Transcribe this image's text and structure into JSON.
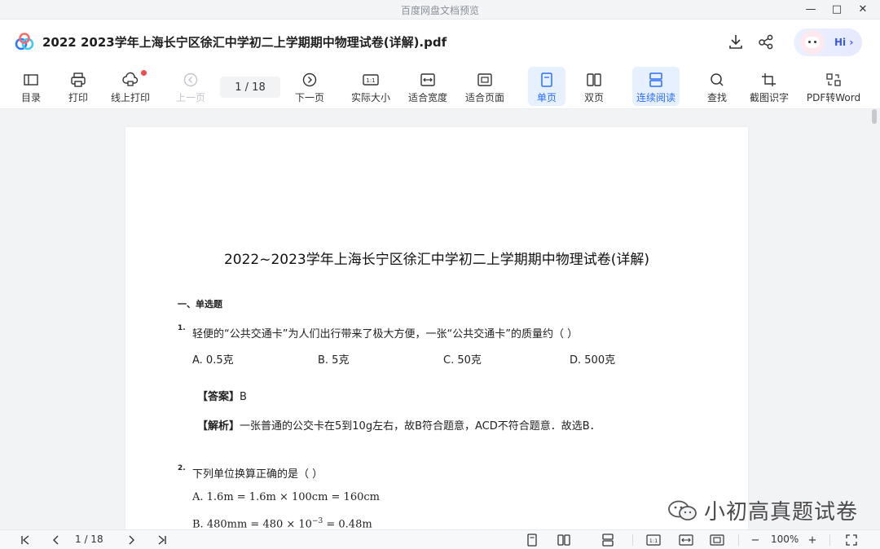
{
  "window": {
    "title": "百度网盘文档预览",
    "controls": {
      "minimize": "—",
      "maximize": "□",
      "close": "✕"
    }
  },
  "header": {
    "doc_title": "2022 2023学年上海长宁区徐汇中学初二上学期期中物理试卷(详解).pdf",
    "hi_label": "Hi ›"
  },
  "toolbar": {
    "toc": "目录",
    "print": "打印",
    "online_print": "线上打印",
    "prev_page": "上一页",
    "page_indicator": "1  /  18",
    "next_page": "下一页",
    "actual_size": "实际大小",
    "fit_width": "适合宽度",
    "fit_page": "适合页面",
    "single_page": "单页",
    "double_page": "双页",
    "continuous": "连续阅读",
    "search": "查找",
    "ocr": "截图识字",
    "pdf_to_word": "PDF转Word"
  },
  "document": {
    "title": "2022~2023学年上海长宁区徐汇中学初二上学期期中物理试卷(详解)",
    "section": "一、单选题",
    "q1": {
      "num": "1.",
      "text": "轻便的“公共交通卡”为人们出行带来了极大方便，一张“公共交通卡”的质量约（     ）",
      "options": [
        "A. 0.5克",
        "B. 5克",
        "C. 50克",
        "D. 500克"
      ],
      "answer_label": "【答案】",
      "answer": "B",
      "analysis_label": "【解析】",
      "analysis": "一张普通的公交卡在5到10g左右，故B符合题意，ACD不符合题意．故选B．"
    },
    "q2": {
      "num": "2.",
      "text": "下列单位换算正确的是（     ）",
      "option_a": "A. 1.6m = 1.6m × 100cm = 160cm",
      "option_b_prefix": "B. 480mm = 480 × 10",
      "option_b_exp": "−3",
      "option_b_suffix": " = 0.48m"
    }
  },
  "watermark": {
    "text": "小初高真题试卷"
  },
  "statusbar": {
    "page_indicator": "1  / 18",
    "zoom": "100%",
    "zoom_out": "−",
    "zoom_in": "+"
  },
  "colors": {
    "accent": "#2a6df5",
    "active_bg": "#e7f0ff",
    "notify_dot": "#f04d4d"
  }
}
